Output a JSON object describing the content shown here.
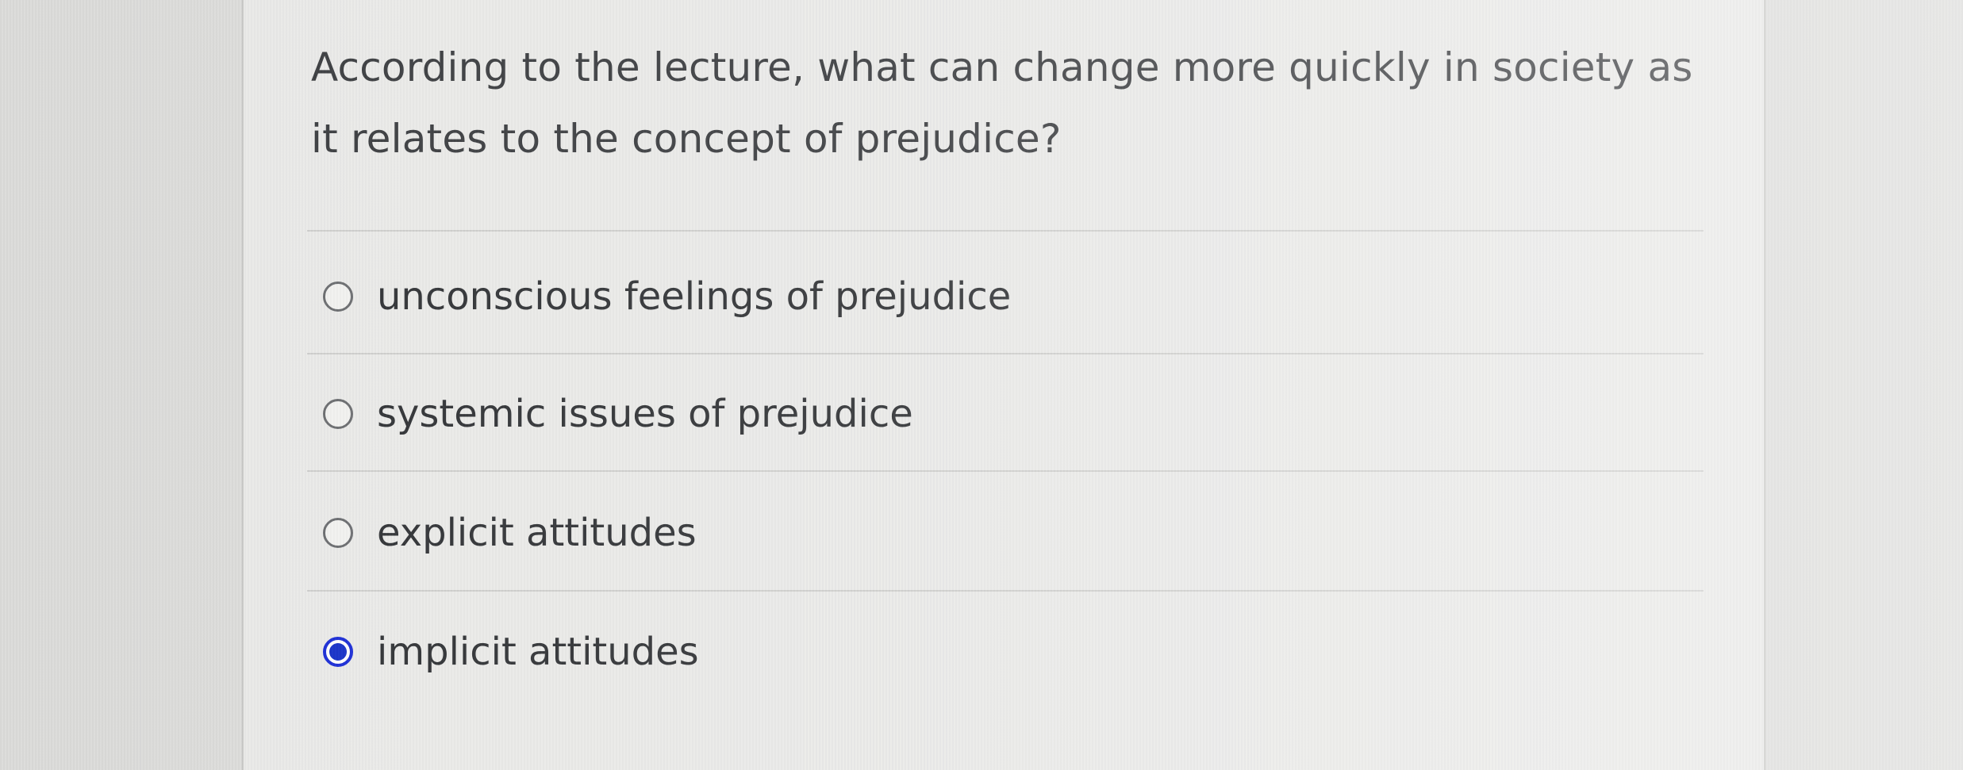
{
  "question": {
    "text": "According to the lecture, what can change more quickly in society as it relates to the concept of prejudice?"
  },
  "options": [
    {
      "label": "unconscious feelings of prejudice",
      "selected": false
    },
    {
      "label": "systemic issues of prejudice",
      "selected": false
    },
    {
      "label": "explicit attitudes",
      "selected": false
    },
    {
      "label": "implicit attitudes",
      "selected": true
    }
  ],
  "colors": {
    "selected_radio": "#1530c8",
    "text": "#2f3134",
    "card_background": "#eaeae8"
  }
}
